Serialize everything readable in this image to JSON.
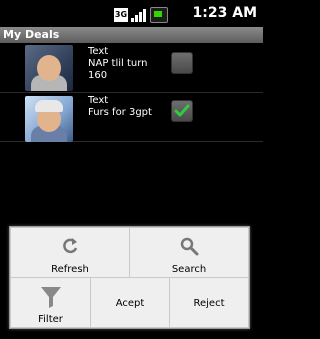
{
  "status_bar": {
    "network_label": "3G",
    "time": "1:23 AM"
  },
  "app": {
    "title": "My Deals"
  },
  "deals": [
    {
      "title": "Text",
      "description_line1": "NAP tlil turn",
      "description_line2": "160",
      "checked": false,
      "avatar_icon": "elder-wizard-avatar"
    },
    {
      "title": "Text",
      "description_line1": "Furs for 3gpt",
      "description_line2": "",
      "checked": true,
      "avatar_icon": "sailor-avatar"
    }
  ],
  "menu": {
    "refresh_label": "Refresh",
    "search_label": "Search",
    "filter_label": "Filter",
    "accept_label": "Acept",
    "reject_label": "Reject"
  },
  "colors": {
    "check_green": "#2ecc40",
    "battery_green": "#34d400",
    "title_bar": "#6e6e6e",
    "menu_bg": "#efefef"
  }
}
